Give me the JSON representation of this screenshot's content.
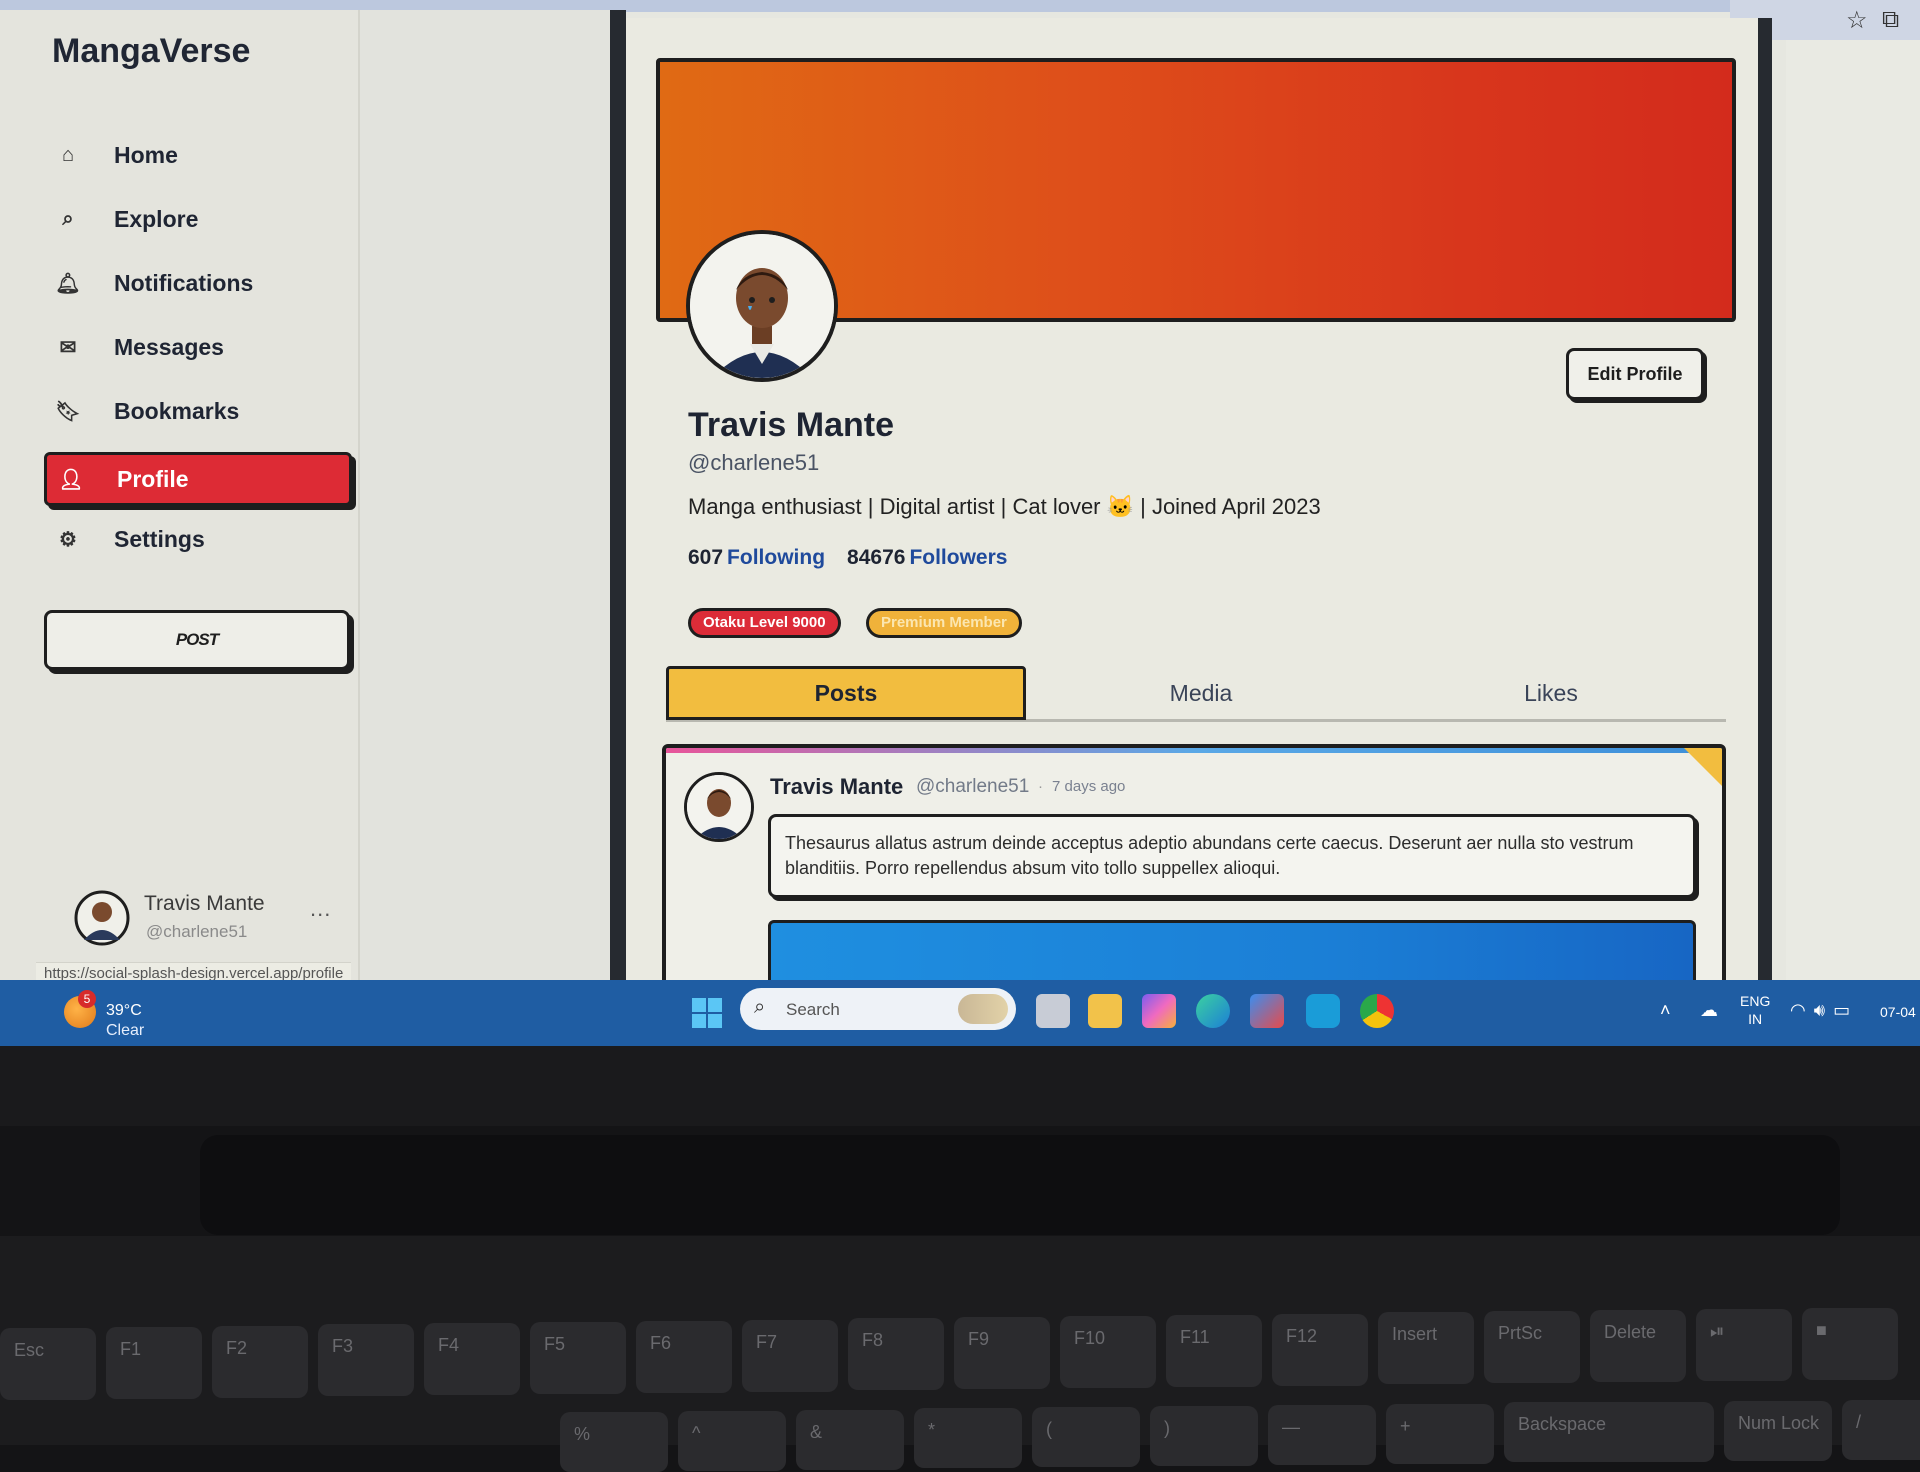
{
  "app": {
    "name": "MangaVerse"
  },
  "browser": {
    "status_url": "https://social-splash-design.vercel.app/profile"
  },
  "sidebar": {
    "items": [
      {
        "label": "Home",
        "icon": "home-icon"
      },
      {
        "label": "Explore",
        "icon": "search-icon"
      },
      {
        "label": "Notifications",
        "icon": "bell-icon"
      },
      {
        "label": "Messages",
        "icon": "mail-icon"
      },
      {
        "label": "Bookmarks",
        "icon": "bookmark-icon"
      },
      {
        "label": "Profile",
        "icon": "user-icon",
        "active": true
      },
      {
        "label": "Settings",
        "icon": "gear-icon"
      }
    ],
    "post_button": "POST",
    "user": {
      "name": "Travis Mante",
      "handle": "@charlene51",
      "more": "..."
    }
  },
  "profile": {
    "name": "Travis Mante",
    "handle": "@charlene51",
    "bio": "Manga enthusiast | Digital artist | Cat lover 🐱 | Joined April 2023",
    "following_count": "607",
    "following_label": "Following",
    "followers_count": "84676",
    "followers_label": "Followers",
    "edit_button": "Edit Profile",
    "badges": [
      "Otaku Level 9000",
      "Premium Member"
    ],
    "banner_colors": [
      "#e06a14",
      "#d32b1c"
    ]
  },
  "tabs": [
    {
      "label": "Posts",
      "active": true
    },
    {
      "label": "Media"
    },
    {
      "label": "Likes"
    }
  ],
  "post": {
    "author": "Travis Mante",
    "handle": "@charlene51",
    "separator": "·",
    "time": "7 days ago",
    "text": "Thesaurus allatus astrum deinde acceptus adeptio abundans certe caecus. Deserunt aer nulla sto vestrum blanditiis. Porro repellendus absum vito tollo suppellex alioqui."
  },
  "taskbar": {
    "weather_badge": "5",
    "temperature": "39°C",
    "condition": "Clear",
    "search_placeholder": "Search",
    "lang_line1": "ENG",
    "lang_line2": "IN",
    "date": "07-04"
  },
  "keyboard": {
    "row1": [
      "Esc",
      "F1",
      "F2",
      "F3",
      "F4",
      "F5",
      "F6",
      "F7",
      "F8",
      "F9",
      "F10",
      "F11",
      "F12",
      "Insert",
      "PrtSc",
      "Delete",
      "⏯",
      "■"
    ],
    "row2": [
      "%",
      "^",
      "&",
      "*",
      "(",
      ")",
      "—",
      "+",
      "Backspace",
      "Num Lock",
      "/"
    ]
  },
  "colors": {
    "accent_red": "#dd2b35",
    "accent_yellow": "#f2bd3f",
    "link_blue": "#1f4a9c",
    "taskbar_blue": "#1f5da3"
  }
}
